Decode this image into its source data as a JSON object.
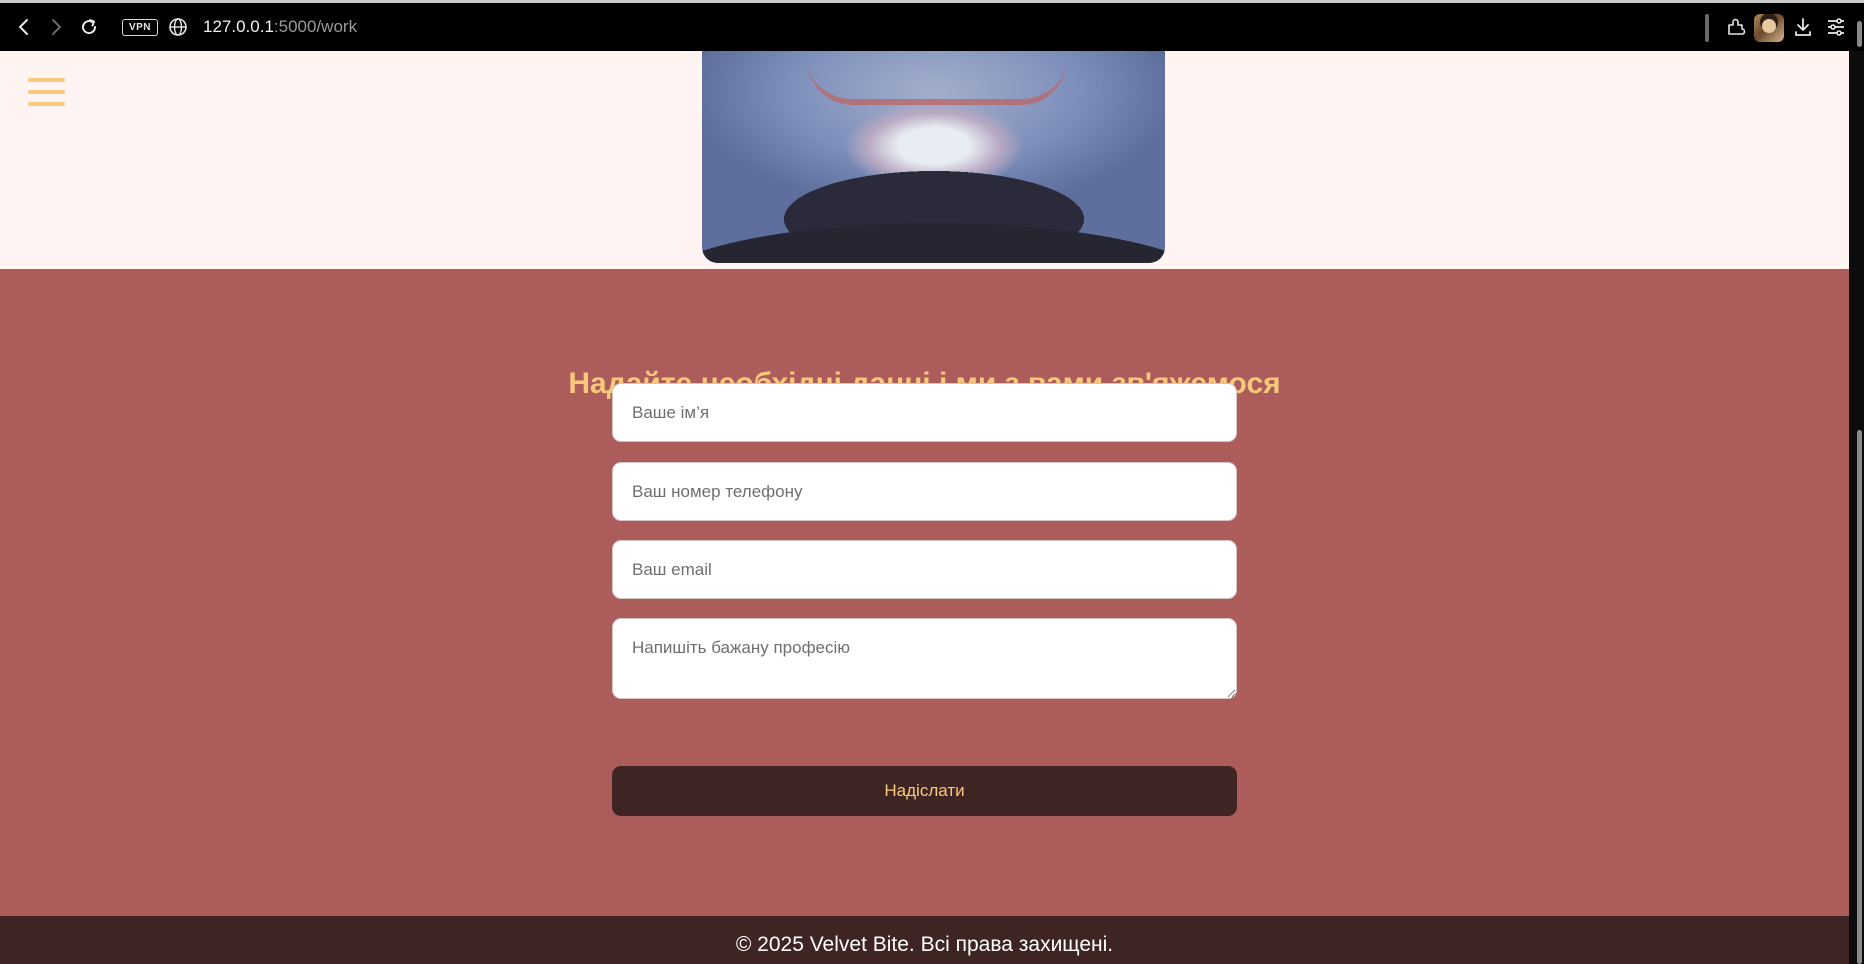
{
  "browser": {
    "address_host": "127.0.0.1",
    "address_path": ":5000/work",
    "vpn_label": "VPN",
    "icons": [
      "back-icon",
      "forward-icon",
      "reload-icon",
      "globe-icon",
      "extensions-icon",
      "profile-avatar",
      "download-icon",
      "menu-icon"
    ]
  },
  "header": {
    "menu_icon": "hamburger-icon"
  },
  "contact": {
    "title": "Надайте необхідні данні і ми з вами зв'яжемося",
    "name_placeholder": "Ваше ім’я",
    "phone_placeholder": "Ваш номер телефону",
    "email_placeholder": "Ваш email",
    "profession_placeholder": "Напишіть бажану професію",
    "submit_label": "Надіслати"
  },
  "footer": {
    "copyright": "© 2025 Velvet Bite. Всі права захищені."
  },
  "colors": {
    "accent": "#f9c97b",
    "section_bg": "#ad5c5c",
    "dark": "#3e2523",
    "page_bg": "#fff4f2"
  }
}
